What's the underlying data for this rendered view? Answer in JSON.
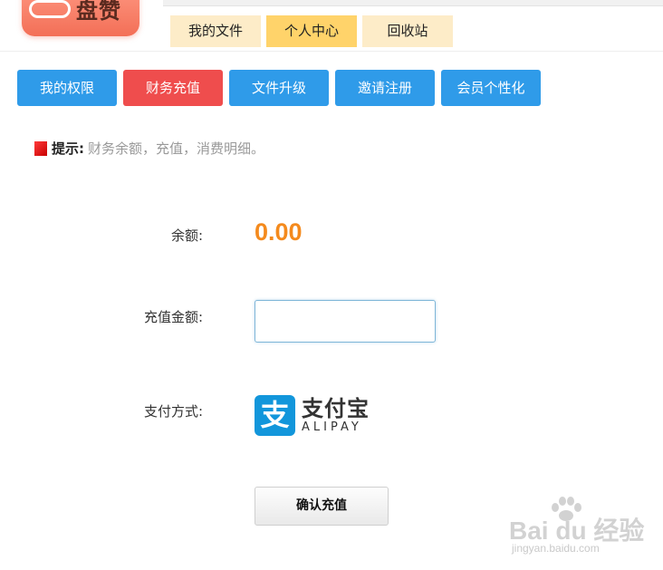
{
  "logo": {
    "text": "盘赞"
  },
  "top_tabs": [
    {
      "label": "我的文件",
      "active": false
    },
    {
      "label": "个人中心",
      "active": true
    },
    {
      "label": "回收站",
      "active": false
    }
  ],
  "nav_buttons": [
    {
      "label": "我的权限",
      "active": false
    },
    {
      "label": "财务充值",
      "active": true
    },
    {
      "label": "文件升级",
      "active": false
    },
    {
      "label": "邀请注册",
      "active": false
    },
    {
      "label": "会员个性化",
      "active": false
    }
  ],
  "tip": {
    "label": "提示:",
    "text": "财务余额，充值，消费明细。"
  },
  "balance": {
    "label": "余额:",
    "value": "0.00"
  },
  "recharge": {
    "label": "充值金额:",
    "value": "",
    "placeholder": ""
  },
  "payment": {
    "label": "支付方式:",
    "method_cn": "支付宝",
    "method_en": "ALIPAY",
    "icon": "alipay-icon"
  },
  "confirm": {
    "label": "确认充值"
  },
  "watermark": {
    "text": "Bai du 经验",
    "url": "jingyan.baidu.com"
  },
  "colors": {
    "nav_blue": "#2f9be9",
    "nav_red": "#ef4d4d",
    "tab_bg": "#fdecc8",
    "tab_active": "#ffd36a",
    "balance_orange": "#f48a1d",
    "alipay_blue": "#1296db"
  }
}
